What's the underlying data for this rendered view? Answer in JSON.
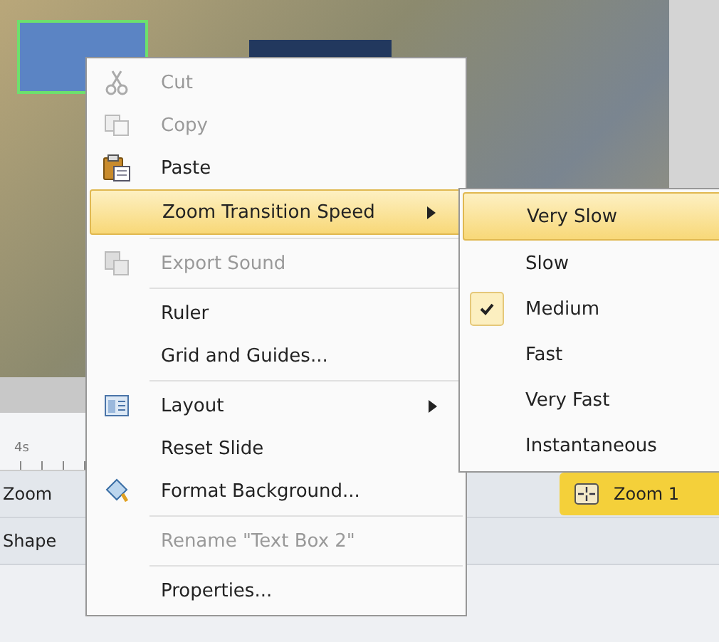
{
  "timeline": {
    "ruler_label": "4s",
    "tracks": [
      {
        "label": "Zoom",
        "clip": "Zoom 1"
      },
      {
        "label": "Shape"
      }
    ]
  },
  "context_menu": {
    "items": [
      {
        "kind": "item",
        "label": "Cut",
        "disabled": true,
        "highlighted": false,
        "submenu": false
      },
      {
        "kind": "item",
        "label": "Copy",
        "disabled": true,
        "highlighted": false,
        "submenu": false
      },
      {
        "kind": "item",
        "label": "Paste",
        "disabled": false,
        "highlighted": false,
        "submenu": false
      },
      {
        "kind": "item",
        "label": "Zoom Transition Speed",
        "disabled": false,
        "highlighted": true,
        "submenu": true
      },
      {
        "kind": "separator"
      },
      {
        "kind": "item",
        "label": "Export Sound",
        "disabled": true,
        "highlighted": false,
        "submenu": false
      },
      {
        "kind": "separator"
      },
      {
        "kind": "item",
        "label": "Ruler",
        "disabled": false,
        "highlighted": false,
        "submenu": false
      },
      {
        "kind": "item",
        "label": "Grid and Guides...",
        "disabled": false,
        "highlighted": false,
        "submenu": false
      },
      {
        "kind": "separator"
      },
      {
        "kind": "item",
        "label": "Layout",
        "disabled": false,
        "highlighted": false,
        "submenu": true
      },
      {
        "kind": "item",
        "label": "Reset Slide",
        "disabled": false,
        "highlighted": false,
        "submenu": false
      },
      {
        "kind": "item",
        "label": "Format Background...",
        "disabled": false,
        "highlighted": false,
        "submenu": false
      },
      {
        "kind": "separator"
      },
      {
        "kind": "item",
        "label": "Rename \"Text Box 2\"",
        "disabled": true,
        "highlighted": false,
        "submenu": false
      },
      {
        "kind": "separator"
      },
      {
        "kind": "item",
        "label": "Properties...",
        "disabled": false,
        "highlighted": false,
        "submenu": false
      }
    ]
  },
  "submenu": {
    "items": [
      {
        "label": "Very Slow",
        "selected": true,
        "checked": false
      },
      {
        "label": "Slow",
        "selected": false,
        "checked": false
      },
      {
        "label": "Medium",
        "selected": false,
        "checked": true
      },
      {
        "label": "Fast",
        "selected": false,
        "checked": false
      },
      {
        "label": "Very Fast",
        "selected": false,
        "checked": false
      },
      {
        "label": "Instantaneous",
        "selected": false,
        "checked": false
      }
    ]
  }
}
